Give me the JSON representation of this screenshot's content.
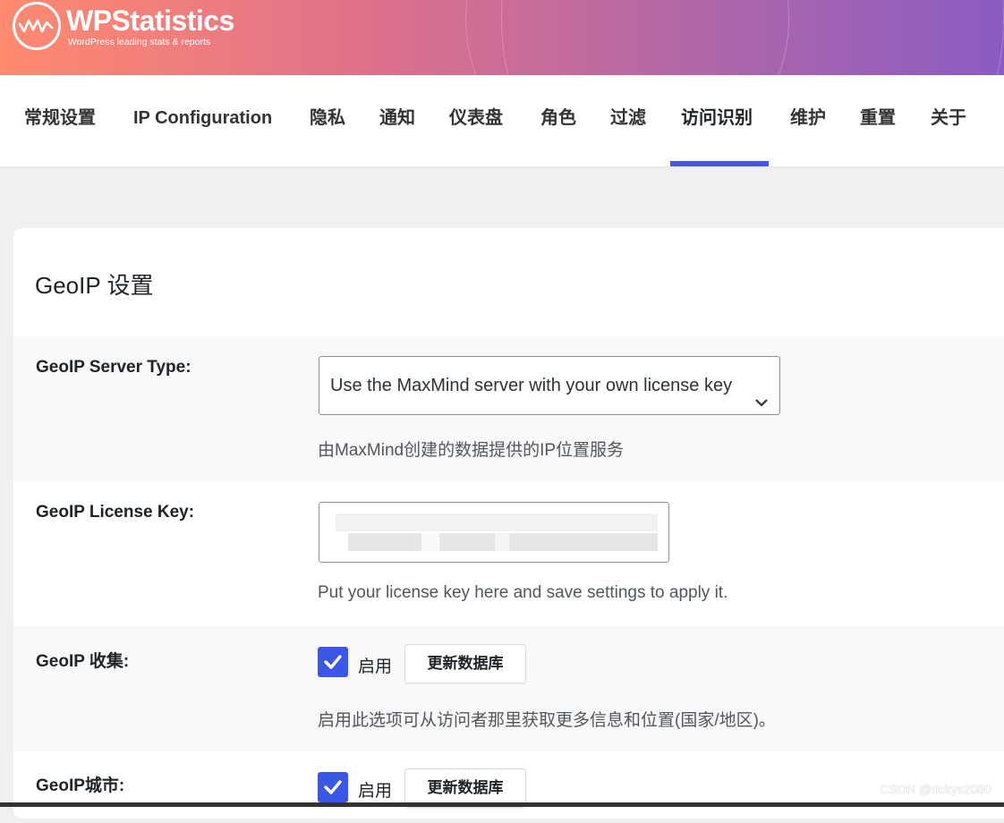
{
  "header": {
    "logo_title": "WPStatistics",
    "logo_subtitle": "WordPress leading stats & reports",
    "gradient_colors": [
      "#ff8a70",
      "#8a5cc2"
    ]
  },
  "tabs": [
    {
      "label": "常规设置"
    },
    {
      "label": "IP Configuration"
    },
    {
      "label": "隐私"
    },
    {
      "label": "通知"
    },
    {
      "label": "仪表盘"
    },
    {
      "label": "角色"
    },
    {
      "label": "过滤"
    },
    {
      "label": "访问识别",
      "active": true
    },
    {
      "label": "维护"
    },
    {
      "label": "重置"
    },
    {
      "label": "关于"
    }
  ],
  "accent_color": "#4a55e0",
  "section": {
    "title": "GeoIP 设置",
    "server_type": {
      "label": "GeoIP Server Type:",
      "selected": "Use the MaxMind server with your own license key",
      "description": "由MaxMind创建的数据提供的IP位置服务"
    },
    "license_key": {
      "label": "GeoIP License Key:",
      "description": "Put your license key here and save settings to apply it."
    },
    "collection": {
      "label": "GeoIP 收集:",
      "checkbox_label": "启用",
      "checked": true,
      "button": "更新数据库",
      "description": "启用此选项可从访问者那里获取更多信息和位置(国家/地区)。"
    },
    "city": {
      "label": "GeoIP城市:",
      "checkbox_label": "启用",
      "checked": true,
      "button": "更新数据库"
    }
  },
  "watermark": "CSDN @rickys2080"
}
